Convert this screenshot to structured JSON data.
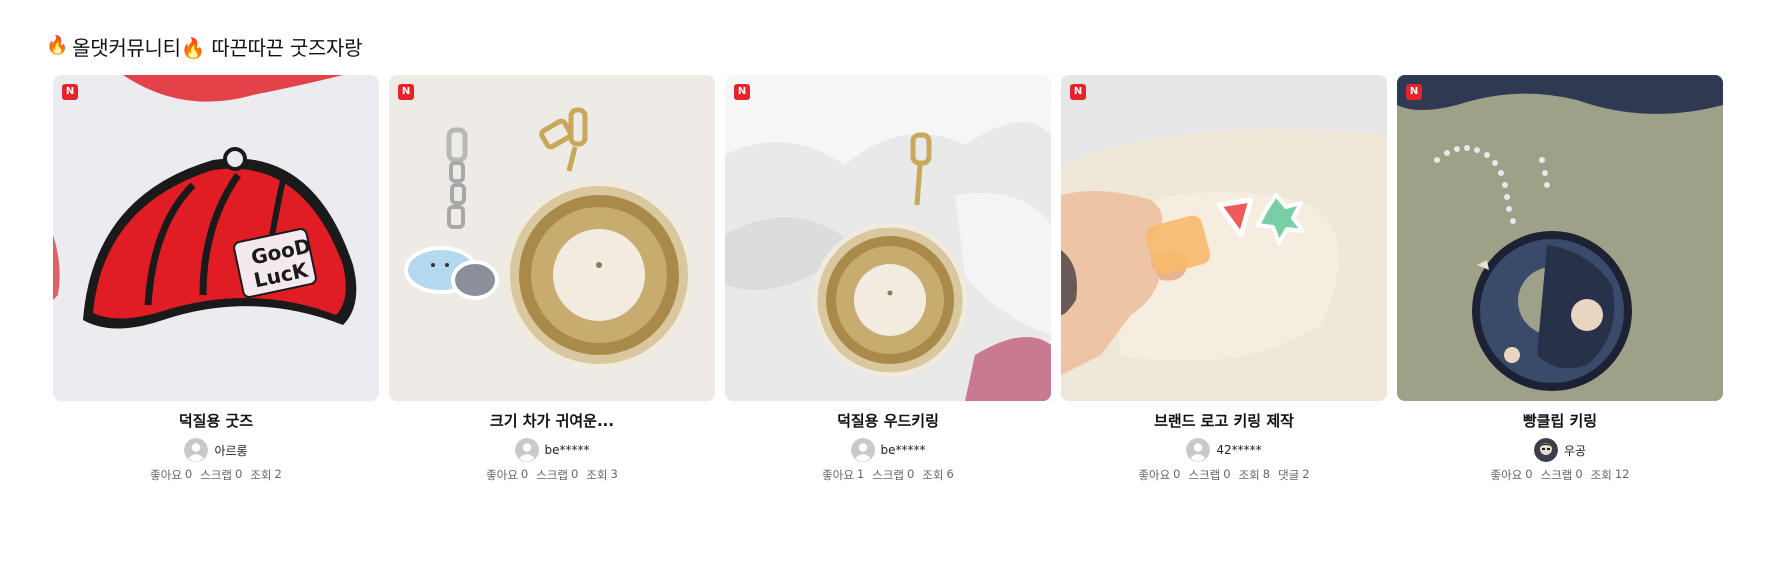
{
  "section": {
    "title_icon": "fire-icon",
    "title": "올댓커뮤니티🔥 따끈따끈 굿즈자랑"
  },
  "stat_labels": {
    "likes": "좋아요",
    "scraps": "스크랩",
    "views": "조회",
    "comments": "댓글"
  },
  "colors": {
    "new_badge": "#e6242a",
    "stats_text": "#666666"
  },
  "cards": [
    {
      "badge": "N",
      "thumb_icon": "red-cap-keyring-photo",
      "title": "덕질용 굿즈",
      "author": "아르롱",
      "avatar_icon": "default-avatar-icon",
      "likes": "0",
      "scraps": "0",
      "views": "2"
    },
    {
      "badge": "N",
      "thumb_icon": "two-keyrings-photo",
      "title": "크기 차가 귀여운...",
      "author": "be*****",
      "avatar_icon": "default-avatar-icon",
      "likes": "0",
      "scraps": "0",
      "views": "3"
    },
    {
      "badge": "N",
      "thumb_icon": "wood-keyring-photo",
      "title": "덕질용 우드키링",
      "author": "be*****",
      "avatar_icon": "default-avatar-icon",
      "likes": "1",
      "scraps": "0",
      "views": "6"
    },
    {
      "badge": "N",
      "thumb_icon": "logo-keyring-hand-photo",
      "title": "브랜드 로고 키링 제작",
      "author": "42*****",
      "avatar_icon": "default-avatar-icon",
      "likes": "0",
      "scraps": "0",
      "views": "8",
      "comments": "2"
    },
    {
      "badge": "N",
      "thumb_icon": "character-keyring-photo",
      "title": "빵클립 키링",
      "author": "우공",
      "avatar_icon": "profile-photo-avatar",
      "likes": "0",
      "scraps": "0",
      "views": "12"
    }
  ]
}
